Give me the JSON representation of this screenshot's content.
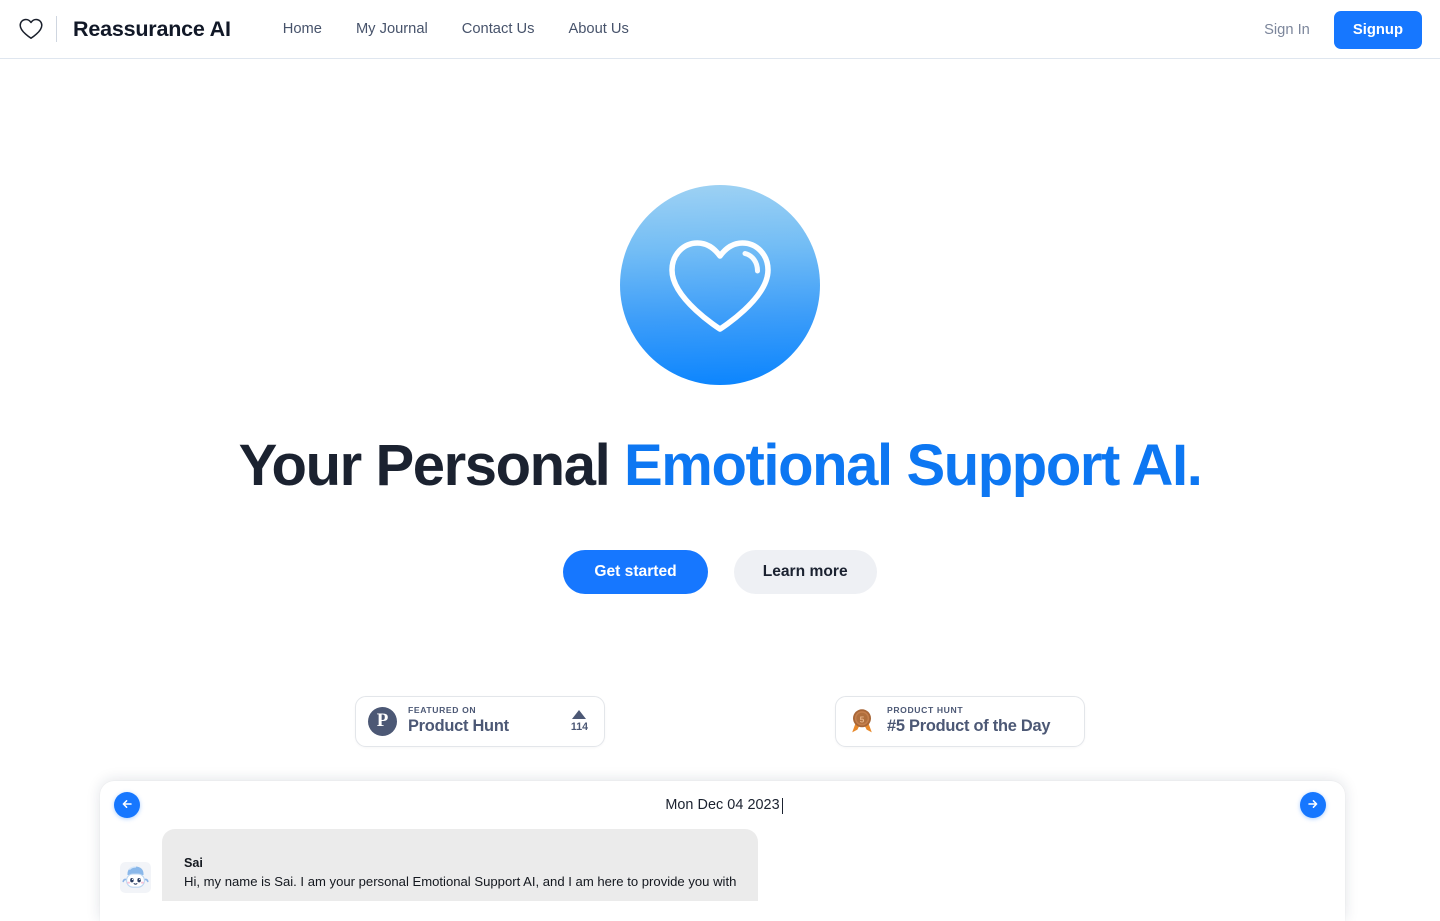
{
  "colors": {
    "accent_blue": "#1677ff",
    "headline_blue": "#0d77f2",
    "headline_dark": "#1b2230",
    "nav_text": "#47536b",
    "product_hunt_slate": "#4c5875",
    "bubble_gray": "#ebebeb",
    "page_background": "#ffffff"
  },
  "header": {
    "logo_icon": "heart-outline-icon",
    "brand_name": "Reassurance AI",
    "nav_links": [
      {
        "label": "Home"
      },
      {
        "label": "My Journal"
      },
      {
        "label": "Contact Us"
      },
      {
        "label": "About Us"
      }
    ],
    "sign_in_label": "Sign In",
    "signup_label": "Signup"
  },
  "hero": {
    "logo_icon": "heart-outline-circle-icon",
    "title_plain": "Your Personal ",
    "title_accent": "Emotional Support AI.",
    "primary_cta": "Get started",
    "secondary_cta": "Learn more"
  },
  "badges": [
    {
      "icon": "product-hunt-p-icon",
      "kicker": "FEATURED ON",
      "main": "Product Hunt",
      "vote_arrow_icon": "triangle-up-icon",
      "vote_count": "114"
    },
    {
      "icon": "bronze-medal-icon",
      "kicker": "PRODUCT HUNT",
      "main": "#5 Product of the Day"
    }
  ],
  "chat": {
    "prev_icon": "arrow-left-icon",
    "next_icon": "arrow-right-icon",
    "date": "Mon Dec 04 2023",
    "messages": [
      {
        "avatar_icon": "robot-avatar-icon",
        "sender": "Sai",
        "text": "Hi, my name is Sai. I am your personal Emotional Support AI, and I am here to provide you with"
      }
    ]
  }
}
